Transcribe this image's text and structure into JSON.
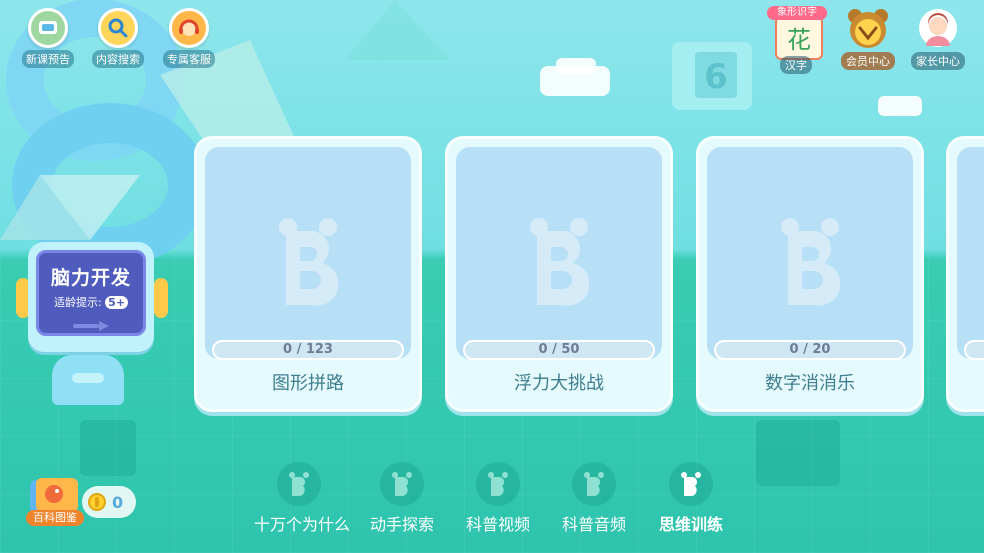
{
  "top_left": [
    {
      "label": "新课预告",
      "icon": "new-course-icon"
    },
    {
      "label": "内容搜索",
      "icon": "search-icon"
    },
    {
      "label": "专属客服",
      "icon": "customer-service-icon"
    }
  ],
  "top_right": [
    {
      "label": "汉字",
      "icon": "hanzi-icon",
      "tag": "象形识字",
      "glyph": "花"
    },
    {
      "label": "会员中心",
      "icon": "vip-icon"
    },
    {
      "label": "家长中心",
      "icon": "parent-icon"
    }
  ],
  "category": {
    "title": "脑力开发",
    "age_label": "适龄提示:",
    "age_value": "5+"
  },
  "cards": [
    {
      "title": "图形拼路",
      "progress": "0 / 123"
    },
    {
      "title": "浮力大挑战",
      "progress": "0 / 50"
    },
    {
      "title": "数字消消乐",
      "progress": "0 / 20"
    },
    {
      "title": "",
      "progress": ""
    }
  ],
  "bottom_nav": [
    {
      "label": "十万个为什么",
      "active": false
    },
    {
      "label": "动手探索",
      "active": false
    },
    {
      "label": "科普视频",
      "active": false
    },
    {
      "label": "科普音频",
      "active": false
    },
    {
      "label": "思维训练",
      "active": true
    }
  ],
  "encyclopedia": {
    "label": "百科图鉴"
  },
  "coins": {
    "value": "0"
  },
  "colors": {
    "accent": "#ffc94a",
    "card_title": "#3f7d8f",
    "category_bg": "#4f5bbd"
  }
}
